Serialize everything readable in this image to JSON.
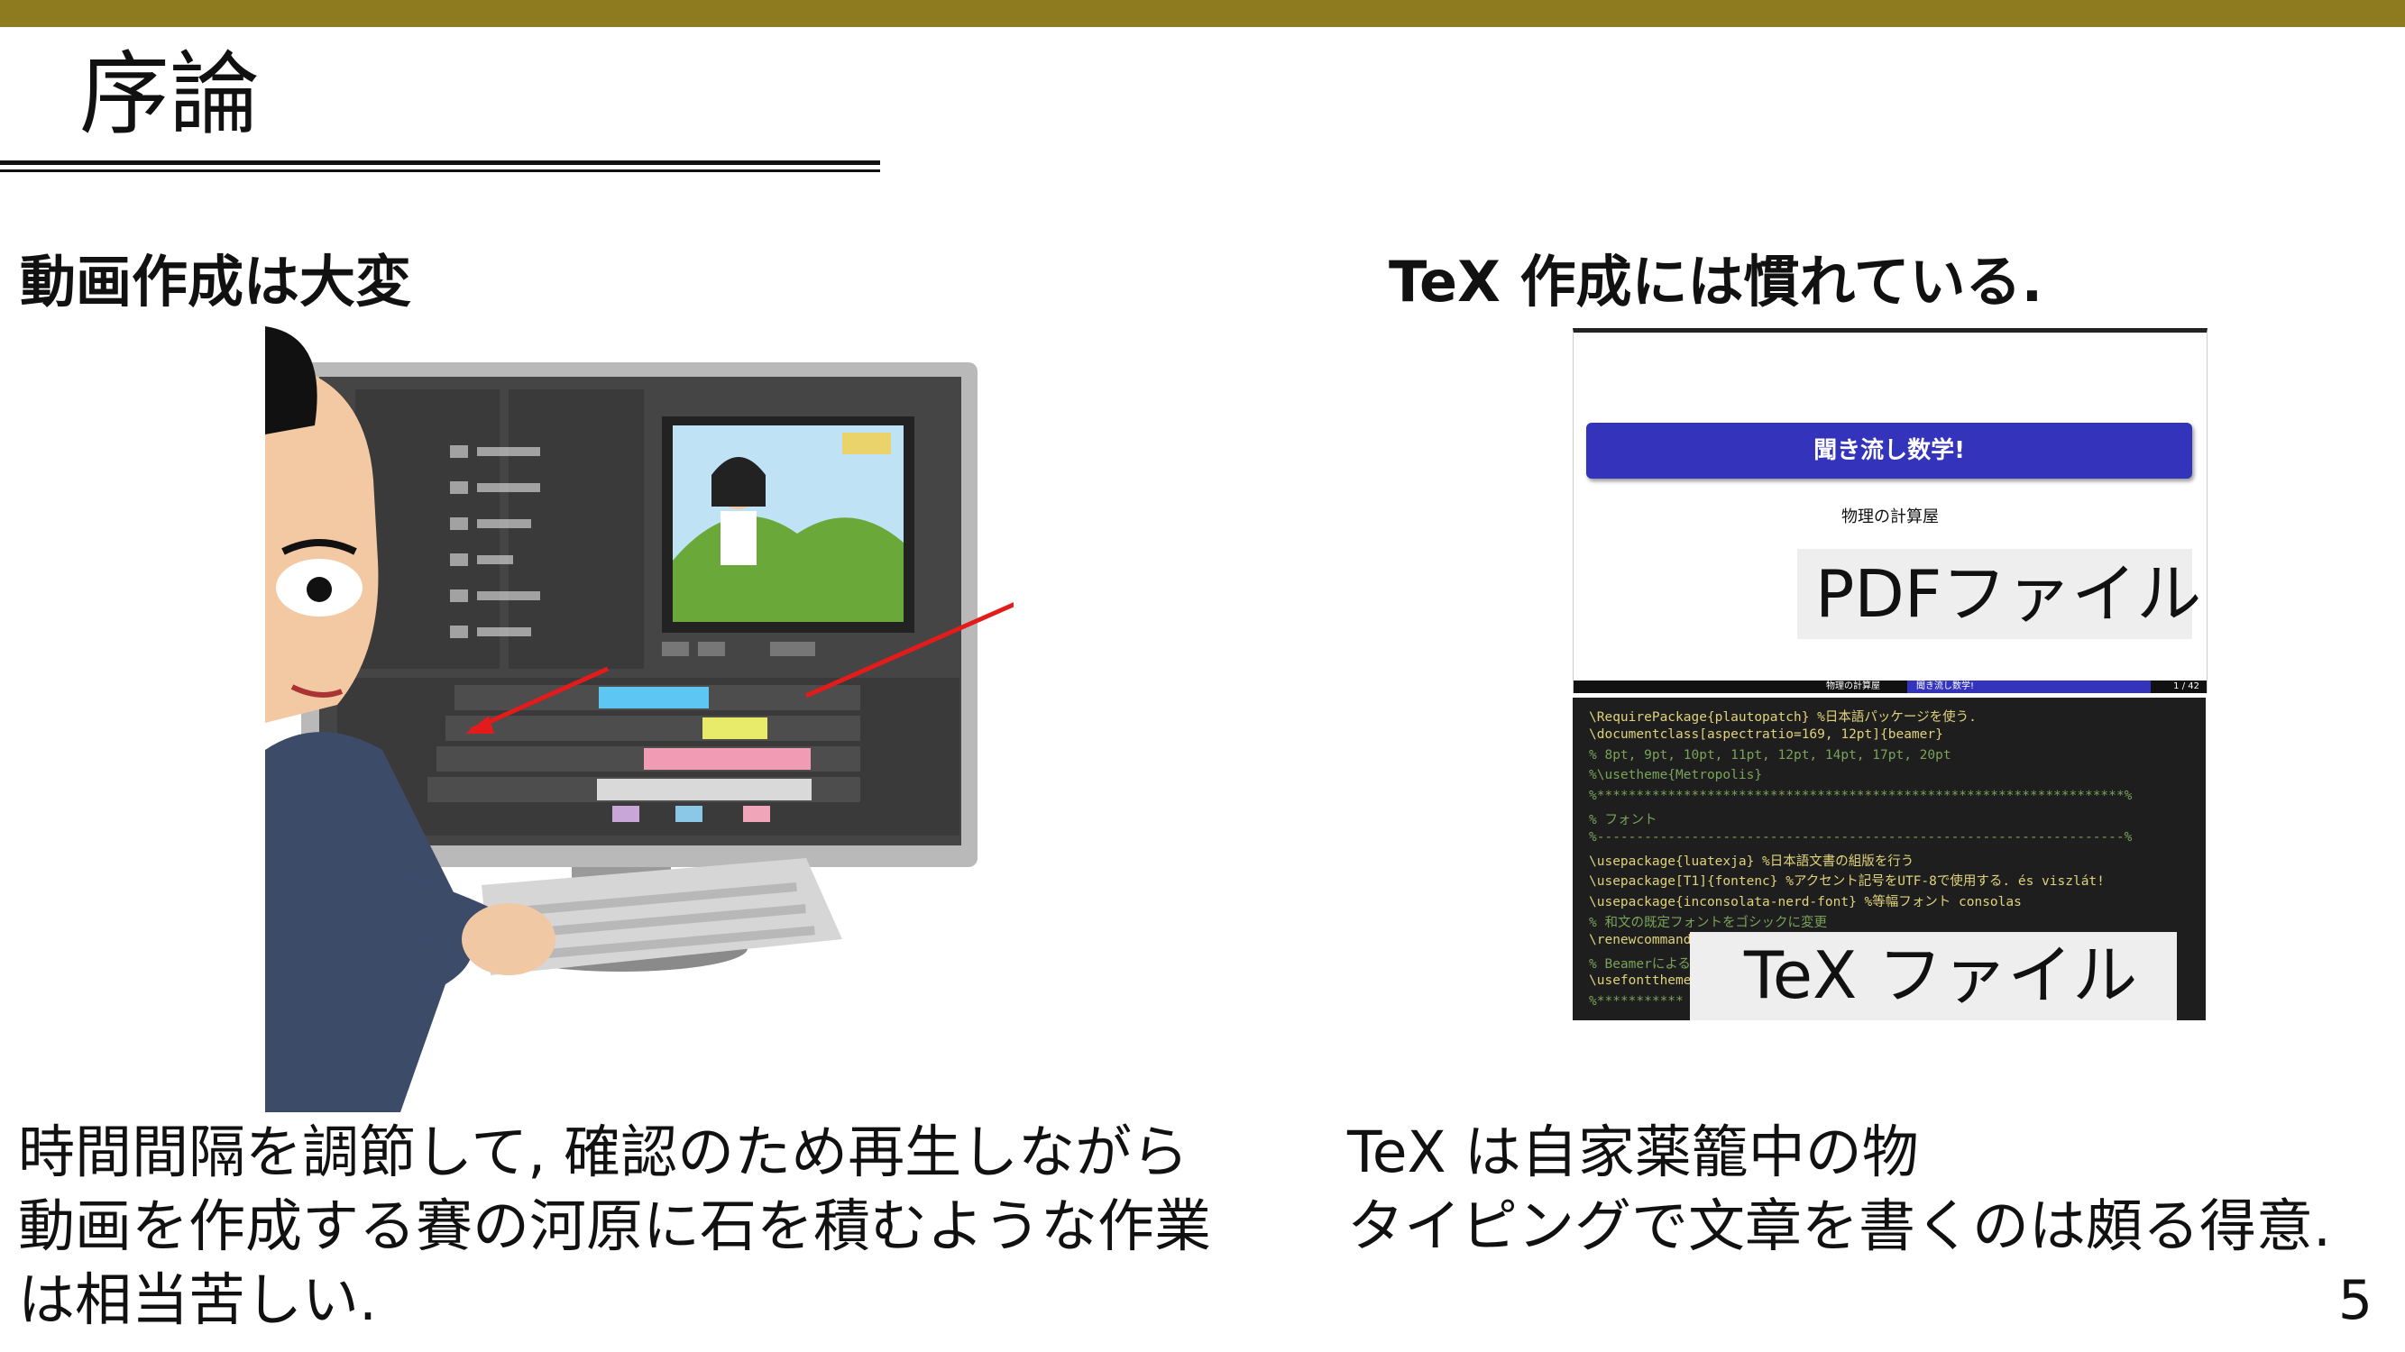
{
  "slide": {
    "title": "序論",
    "page_number": "5",
    "accent_color": "#8e7a1f"
  },
  "left": {
    "heading": "動画作成は大変",
    "body_lines": [
      "時間間隔を調節して, 確認のため再生しながら",
      "動画を作成する賽の河原に石を積むような作業",
      "は相当苦しい."
    ]
  },
  "right": {
    "heading": "TeX 作成には慣れている.",
    "body_lines": [
      "TeX は自家薬籠中の物",
      "タイピングで文章を書くのは頗る得意."
    ],
    "pdf_thumb": {
      "banner": "聞き流し数学!",
      "author": "物理の計算屋",
      "label": "PDFファイル",
      "footer_author": "物理の計算屋",
      "footer_title": "聞き流し数学!",
      "footer_page": "1 / 42"
    },
    "tex_thumb": {
      "label": "TeX ファイル",
      "code_lines": [
        "\\RequirePackage{plautopatch} %日本語パッケージを使う.",
        "\\documentclass[aspectratio=169, 12pt]{beamer}",
        "%  8pt, 9pt, 10pt, 11pt, 12pt, 14pt, 17pt, 20pt",
        "%\\usetheme{Metropolis}",
        "%*******************************************************************%",
        "% フォント",
        "%-------------------------------------------------------------------%",
        "\\usepackage{luatexja} %日本語文書の組版を行う",
        "\\usepackage[T1]{fontenc} %アクセント記号をUTF-8で使用する. és viszlát!",
        "\\usepackage{inconsolata-nerd-font} %等幅フォント consolas",
        "% 和文の既定フォントをゴシックに変更",
        "\\renewcommand",
        "% Beamerによる",
        "\\usefonttheme",
        "%***********"
      ]
    }
  }
}
